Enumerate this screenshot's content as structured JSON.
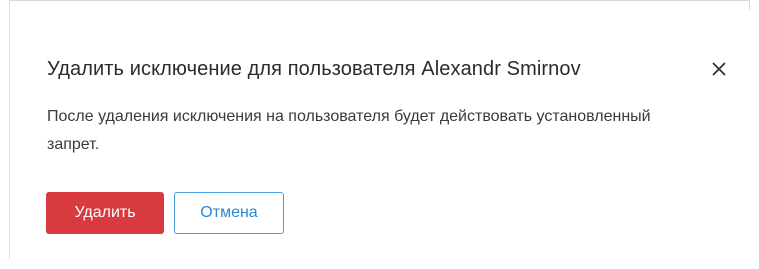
{
  "dialog": {
    "title": "Удалить исключение для пользователя Alexandr Smirnov",
    "message": "После удаления исключения на пользователя будет действовать установленный запрет.",
    "close_icon": "close-icon",
    "actions": {
      "delete_label": "Удалить",
      "cancel_label": "Отмена"
    }
  },
  "colors": {
    "danger": "#d93a3f",
    "accent": "#2f86d1",
    "text": "#2b2b2b"
  }
}
